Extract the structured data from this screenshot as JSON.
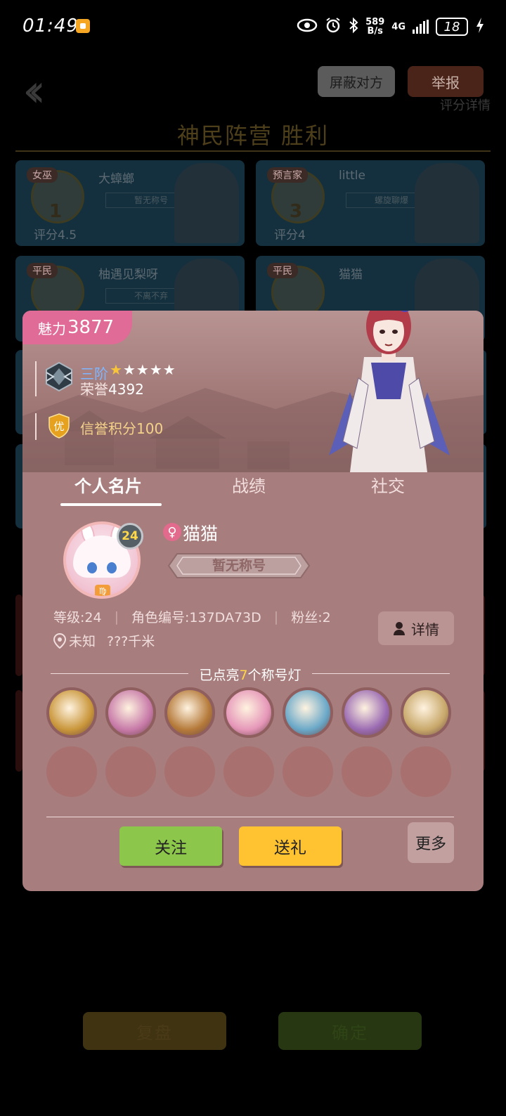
{
  "status_bar": {
    "time": "01:49",
    "net_speed_top": "589",
    "net_speed_bottom": "B/s",
    "network": "4G",
    "battery": "18"
  },
  "background": {
    "block_label": "屏蔽对方",
    "report_label": "举报",
    "score_detail": "评分详情",
    "result_title": "神民阵营  胜利",
    "players": [
      {
        "role": "女巫",
        "number": "1",
        "name": "大蟑螂",
        "title": "暂无称号",
        "score": "评分4.5"
      },
      {
        "role": "预言家",
        "number": "3",
        "name": "little",
        "title": "螺旋聊爆",
        "score": "评分4"
      },
      {
        "role": "平民",
        "number": "",
        "name": "柚遇见梨呀",
        "title": "不离不弃",
        "score": ""
      },
      {
        "role": "平民",
        "number": "",
        "name": "猫猫",
        "title": "",
        "score": ""
      }
    ],
    "replay_label": "复盘",
    "confirm_label": "确定"
  },
  "profile": {
    "charm_label": "魅力",
    "charm_value": "3877",
    "rank_name": "三阶",
    "rank_stars_lit": 1,
    "rank_stars_total": 5,
    "honor_label": "荣誉",
    "honor_value": "4392",
    "credit_badge": "优",
    "credit_text": "信誉积分100",
    "tabs": [
      "个人名片",
      "战绩",
      "社交"
    ],
    "active_tab": 0,
    "level": "24",
    "zodiac": "♍",
    "gender_icon": "♀",
    "nickname": "猫猫",
    "title_plate": "暂无称号",
    "stats": {
      "level": "等级:24",
      "role_id": "角色编号:137DA73D",
      "fans": "粉丝:2"
    },
    "location": "未知",
    "distance": "???千米",
    "detail_label": "详情",
    "lamps_prefix": "已点亮",
    "lamps_count": "7",
    "lamps_suffix": "个称号灯",
    "lamps": [
      {
        "icon": "werewolf-lamp-icon",
        "color": "#c9963a"
      },
      {
        "icon": "potion-lamp-icon",
        "color": "#c77aa8"
      },
      {
        "icon": "claw-lamp-icon",
        "color": "#b57a3a"
      },
      {
        "icon": "cupid-lamp-icon",
        "color": "#e596b8"
      },
      {
        "icon": "seer-eye-lamp-icon",
        "color": "#6aa8c8"
      },
      {
        "icon": "crown-lamp-icon",
        "color": "#9b6bb2"
      },
      {
        "icon": "knight-lamp-icon",
        "color": "#c8a86a"
      }
    ],
    "follow_label": "关注",
    "gift_label": "送礼",
    "more_label": "更多"
  }
}
